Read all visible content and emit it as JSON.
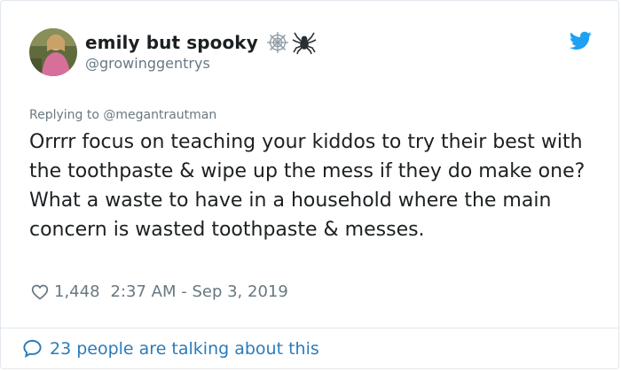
{
  "tweet": {
    "display_name": "emily but spooky",
    "name_emojis": [
      "spider-web-icon",
      "spider-icon"
    ],
    "handle": "@growinggentrys",
    "replying_to": "Replying to @megantrautman",
    "text": "Orrrr focus on teaching your kiddos to try their best with the toothpaste & wipe up the mess if they do make one? What a waste to have in a household where the main concern is wasted toothpaste & messes.",
    "like_count": "1,448",
    "timestamp": "2:37 AM - Sep 3, 2019",
    "talking_about": "23 people are talking about this"
  },
  "colors": {
    "accent": "#1da1f2",
    "link": "#2b7bb9",
    "secondary_text": "#697882",
    "primary_text": "#1c2022",
    "border": "#e1e8ed"
  }
}
